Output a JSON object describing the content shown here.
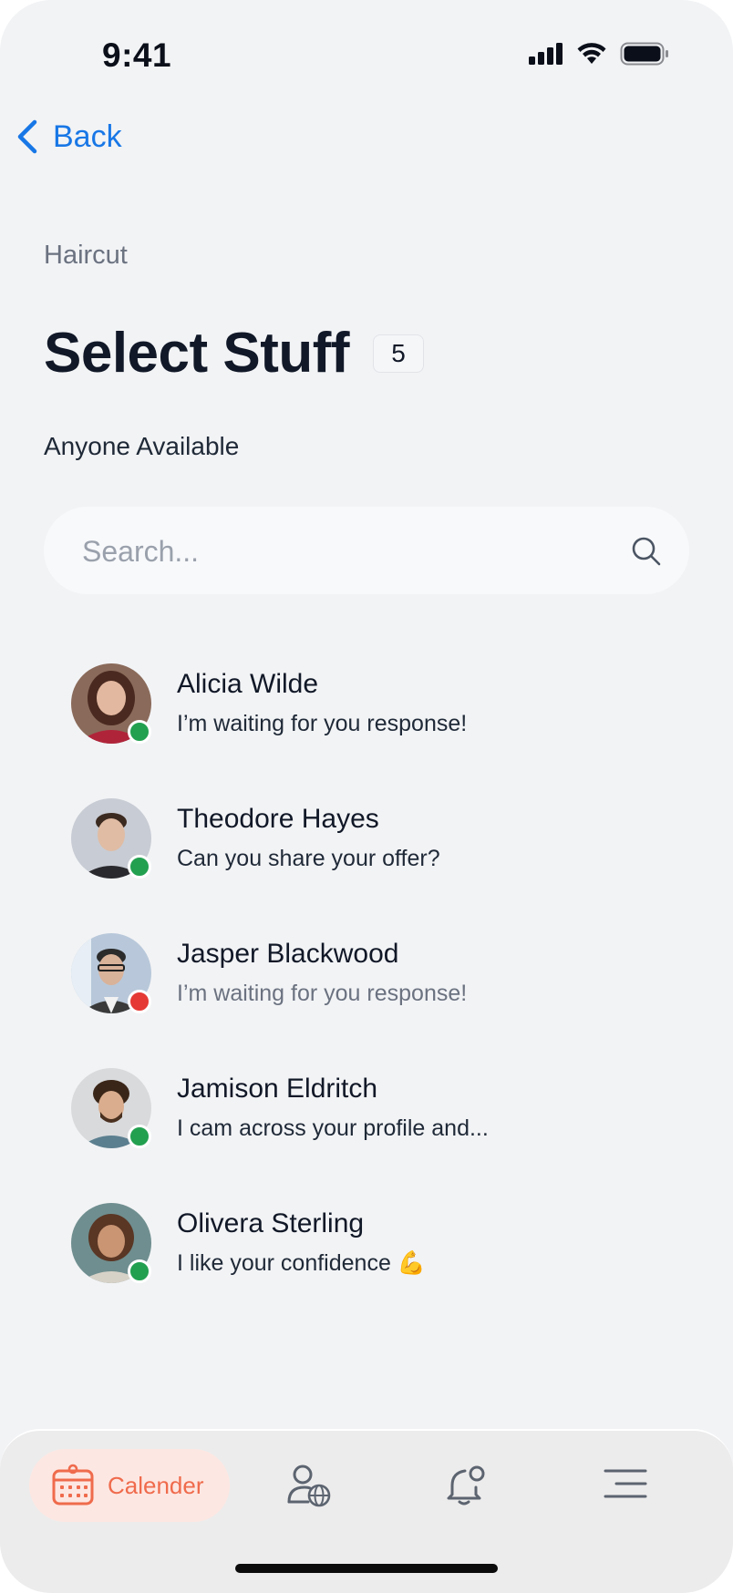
{
  "status_bar": {
    "time": "9:41"
  },
  "nav_back": {
    "label": "Back"
  },
  "header": {
    "eyebrow": "Haircut",
    "title": "Select Stuff",
    "count": "5",
    "subtitle": "Anyone Available"
  },
  "search": {
    "placeholder": "Search..."
  },
  "contacts": [
    {
      "name": "Alicia Wilde",
      "message": "I’m waiting for you response!",
      "status": "online",
      "status_color": "#22a050",
      "muted": false,
      "avatar_colors": [
        "#c9a08a",
        "#b0243a"
      ]
    },
    {
      "name": "Theodore Hayes",
      "message": "Can you share your offer?",
      "status": "online",
      "status_color": "#22a050",
      "muted": false,
      "avatar_colors": [
        "#c8ccd4",
        "#2a2a2e"
      ]
    },
    {
      "name": "Jasper Blackwood",
      "message": "I’m waiting for you response!",
      "status": "busy",
      "status_color": "#e53935",
      "muted": true,
      "avatar_colors": [
        "#b8c8da",
        "#3a3a3a"
      ]
    },
    {
      "name": "Jamison Eldritch",
      "message": "I cam across your profile and...",
      "status": "online",
      "status_color": "#22a050",
      "muted": false,
      "avatar_colors": [
        "#d8dadc",
        "#5b7f8f"
      ]
    },
    {
      "name": "Olivera Sterling",
      "message": "I like your confidence 💪",
      "status": "online",
      "status_color": "#22a050",
      "muted": false,
      "avatar_colors": [
        "#6f8e8f",
        "#7a4a32"
      ]
    }
  ],
  "bottom_nav": {
    "active_label": "Calender",
    "items": [
      "calendar-icon",
      "user-globe-icon",
      "bell-icon",
      "menu-icon"
    ],
    "accent": "#ef6b4c"
  },
  "colors": {
    "link": "#1877e6",
    "background": "#f2f3f5"
  }
}
